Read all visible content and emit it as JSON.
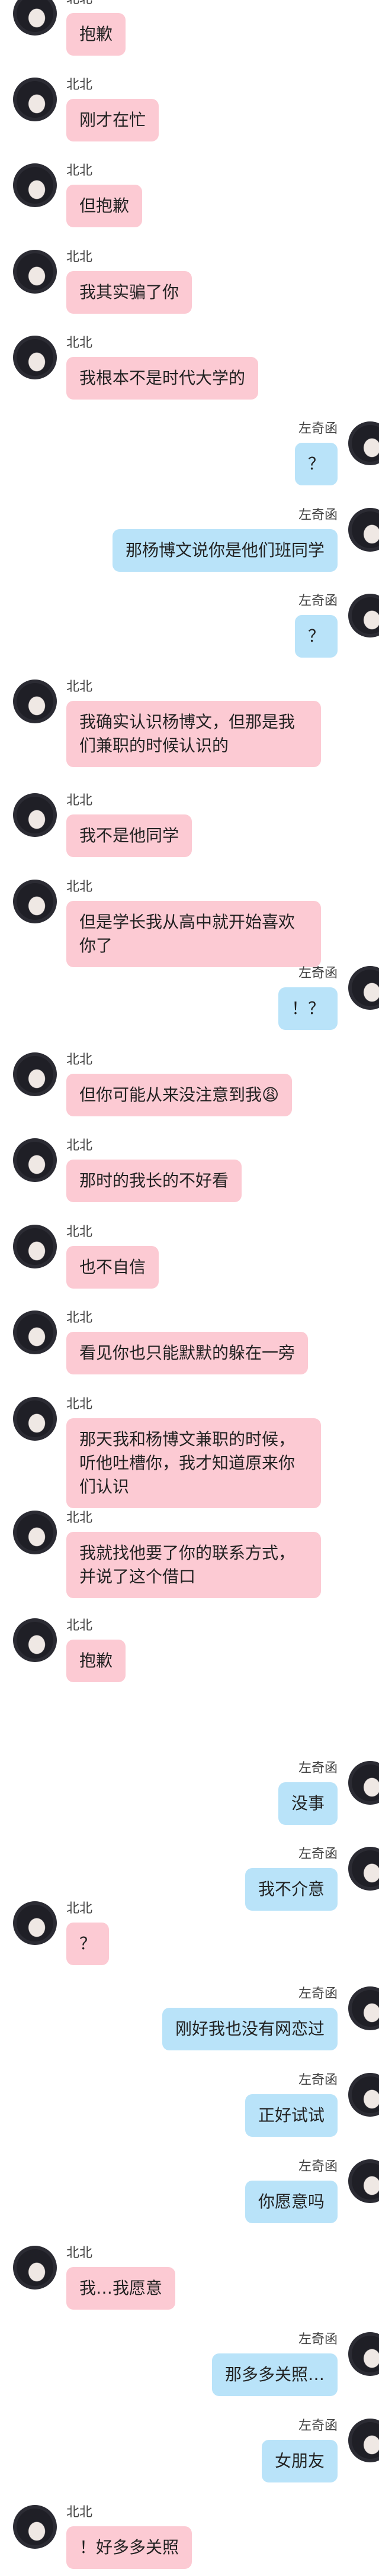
{
  "messages": [
    {
      "side": "left",
      "name": "北北",
      "text": "抱歉"
    },
    {
      "side": "left",
      "name": "北北",
      "text": "刚才在忙"
    },
    {
      "side": "left",
      "name": "北北",
      "text": "但抱歉"
    },
    {
      "side": "left",
      "name": "北北",
      "text": "我其实骗了你"
    },
    {
      "side": "left",
      "name": "北北",
      "text": "我根本不是时代大学的"
    },
    {
      "side": "right",
      "name": "左奇函",
      "text": "？"
    },
    {
      "side": "right",
      "name": "左奇函",
      "text": "那杨博文说你是他们班同学"
    },
    {
      "side": "right",
      "name": "左奇函",
      "text": "？"
    },
    {
      "side": "left",
      "name": "北北",
      "text": "我确实认识杨博文，但那是我们兼职的时候认识的"
    },
    {
      "side": "left",
      "name": "北北",
      "text": "我不是他同学"
    },
    {
      "side": "left",
      "name": "北北",
      "text": "但是学长我从高中就开始喜欢你了"
    },
    {
      "side": "right",
      "name": "左奇函",
      "text": "！？"
    },
    {
      "side": "left",
      "name": "北北",
      "text": "但你可能从来没注意到我😩"
    },
    {
      "side": "left",
      "name": "北北",
      "text": "那时的我长的不好看"
    },
    {
      "side": "left",
      "name": "北北",
      "text": "也不自信"
    },
    {
      "side": "left",
      "name": "北北",
      "text": "看见你也只能默默的躲在一旁"
    },
    {
      "side": "left",
      "name": "北北",
      "text": "那天我和杨博文兼职的时候，听他吐槽你，我才知道原来你们认识"
    },
    {
      "side": "left",
      "name": "北北",
      "text": "我就找他要了你的联系方式，并说了这个借口"
    },
    {
      "side": "left",
      "name": "北北",
      "text": "抱歉"
    },
    {
      "side": "right",
      "name": "左奇函",
      "text": "没事"
    },
    {
      "side": "right",
      "name": "左奇函",
      "text": "我不介意"
    },
    {
      "side": "left",
      "name": "北北",
      "text": "？"
    },
    {
      "side": "right",
      "name": "左奇函",
      "text": "刚好我也没有网恋过"
    },
    {
      "side": "right",
      "name": "左奇函",
      "text": "正好试试"
    },
    {
      "side": "right",
      "name": "左奇函",
      "text": "你愿意吗"
    },
    {
      "side": "left",
      "name": "北北",
      "text": "我…我愿意"
    },
    {
      "side": "right",
      "name": "左奇函",
      "text": "那多多关照…"
    },
    {
      "side": "right",
      "name": "左奇函",
      "text": "女朋友"
    },
    {
      "side": "left",
      "name": "北北",
      "text": "！好多多关照"
    }
  ]
}
